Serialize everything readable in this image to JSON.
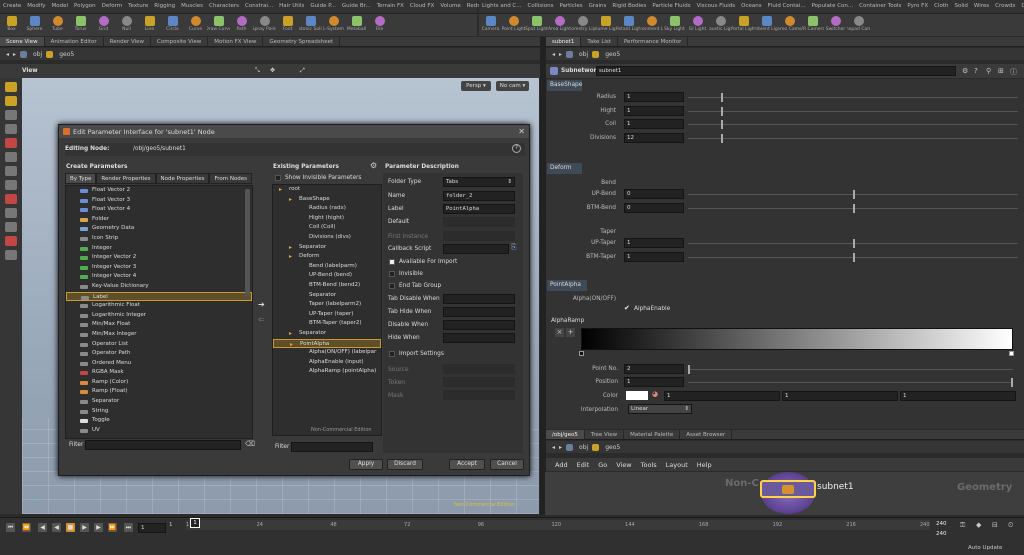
{
  "shelf_left": {
    "tabs": [
      "Create",
      "Modify",
      "Model",
      "Polygon",
      "Deform",
      "Texture",
      "Rigging",
      "Muscles",
      "Characters",
      "Constrai...",
      "Hair Utils",
      "Guide P...",
      "Guide Br...",
      "Terrain FX",
      "Cloud FX",
      "Volume",
      "Redshift"
    ],
    "tools": [
      "Box",
      "Sphere",
      "Tube",
      "Torus",
      "Grid",
      "Null",
      "Line",
      "Circle",
      "Curve",
      "Draw Curve",
      "Path",
      "Spray Paint",
      "Font",
      "Platonic Solids",
      "L-System",
      "Metaball",
      "File"
    ]
  },
  "shelf_right": {
    "tabs": [
      "Lights and C...",
      "Collisions",
      "Particles",
      "Grains",
      "Rigid Bodies",
      "Particle Fluids",
      "Viscous Fluids",
      "Oceans",
      "Fluid Contai...",
      "Populate Con...",
      "Container Tools",
      "Pyro FX",
      "Cloth",
      "Solid",
      "Wires",
      "Crowds",
      "Drive Simula..."
    ],
    "tools": [
      "Camera",
      "Point Light",
      "Spot Light",
      "Area Light",
      "Geometry Light",
      "Volume Light",
      "Distant Light",
      "Environment Light",
      "Sky Light",
      "GI Light",
      "Caustic Light",
      "Portal Light",
      "Ambient Light",
      "Stereo Camera",
      "VR Camera",
      "Switcher",
      "Gamepad Camera"
    ]
  },
  "left_panel": {
    "tabs": [
      "Scene View",
      "Animation Editor",
      "Render View",
      "Composite View",
      "Motion FX View",
      "Geometry Spreadsheet"
    ],
    "path": [
      "obj",
      "geo5"
    ],
    "view_label": "View",
    "persp": "Persp ▾",
    "nocam": "No cam ▾",
    "non_commercial": "Non-Commercial Edition"
  },
  "dialog": {
    "title": "Edit Parameter Interface for 'subnet1' Node",
    "editing_node_label": "Editing Node:",
    "editing_node_value": "/obj/geo5/subnet1",
    "create_params": {
      "title": "Create Parameters",
      "tabs": [
        "By Type",
        "Render Properties",
        "Node Properties",
        "From Nodes"
      ],
      "items": [
        {
          "label": "Float Vector 2",
          "color": "#6b8fd6"
        },
        {
          "label": "Float Vector 3",
          "color": "#6b8fd6"
        },
        {
          "label": "Float Vector 4",
          "color": "#6b8fd6"
        },
        {
          "label": "Folder",
          "color": "#d4a84a"
        },
        {
          "label": "Geometry Data",
          "color": "#7aa0d8"
        },
        {
          "label": "Icon Strip",
          "color": "#8a8a8a"
        },
        {
          "label": "Integer",
          "color": "#4fae4f"
        },
        {
          "label": "Integer Vector 2",
          "color": "#4fae4f"
        },
        {
          "label": "Integer Vector 3",
          "color": "#4fae4f"
        },
        {
          "label": "Integer Vector 4",
          "color": "#4fae4f"
        },
        {
          "label": "Key-Value Dictionary",
          "color": "#8a8a8a"
        },
        {
          "label": "Label",
          "color": "#8a8a8a"
        },
        {
          "label": "Logarithmic Float",
          "color": "#8a8a8a"
        },
        {
          "label": "Logarithmic Integer",
          "color": "#8a8a8a"
        },
        {
          "label": "Min/Max Float",
          "color": "#8a8a8a"
        },
        {
          "label": "Min/Max Integer",
          "color": "#8a8a8a"
        },
        {
          "label": "Operator List",
          "color": "#8a8a8a"
        },
        {
          "label": "Operator Path",
          "color": "#8a8a8a"
        },
        {
          "label": "Ordered Menu",
          "color": "#8a8a8a"
        },
        {
          "label": "RGBA Mask",
          "color": "#c24646"
        },
        {
          "label": "Ramp (Color)",
          "color": "#d98a3a"
        },
        {
          "label": "Ramp (Float)",
          "color": "#d98a3a"
        },
        {
          "label": "Separator",
          "color": "#8a8a8a"
        },
        {
          "label": "String",
          "color": "#8a8a8a"
        },
        {
          "label": "Toggle",
          "color": "#dddddd"
        },
        {
          "label": "UV",
          "color": "#8a8a8a"
        }
      ],
      "selected_index": 11,
      "filter_label": "Filter"
    },
    "existing_params": {
      "title": "Existing Parameters",
      "show_invisible": "Show Invisible Parameters",
      "items": [
        {
          "label": "root",
          "indent": 1
        },
        {
          "label": "BaseShape",
          "indent": 2
        },
        {
          "label": "Radius (radx)",
          "indent": 3
        },
        {
          "label": "Hight (hight)",
          "indent": 3
        },
        {
          "label": "Coil (Coil)",
          "indent": 3
        },
        {
          "label": "Divisions (divs)",
          "indent": 3
        },
        {
          "label": "Separator",
          "indent": 2
        },
        {
          "label": "Deform",
          "indent": 2
        },
        {
          "label": "Bend (labelparm)",
          "indent": 3
        },
        {
          "label": "UP-Bend (bend)",
          "indent": 3
        },
        {
          "label": "BTM-Bend (bend2)",
          "indent": 3
        },
        {
          "label": "Separator",
          "indent": 3
        },
        {
          "label": "Taper (labelparm2)",
          "indent": 3
        },
        {
          "label": "UP-Taper (taper)",
          "indent": 3
        },
        {
          "label": "BTM-Taper (taper2)",
          "indent": 3
        },
        {
          "label": "Separator",
          "indent": 2
        },
        {
          "label": "PointAlpha",
          "indent": 2
        },
        {
          "label": "Alpha(ON/OFF) (labelpar",
          "indent": 3
        },
        {
          "label": "AlphaEnable (input)",
          "indent": 3
        },
        {
          "label": "AlphaRamp (pointAlpha)",
          "indent": 3
        }
      ],
      "selected_index": 16,
      "filter_label": "Filter",
      "non_commercial": "Non-Commercial Edition"
    },
    "param_desc": {
      "title": "Parameter Description",
      "folder_type_label": "Folder Type",
      "folder_type_value": "Tabs",
      "name_label": "Name",
      "name_value": "folder_2",
      "label_label": "Label",
      "label_value": "PointAlpha",
      "default_label": "Default",
      "first_instance_label": "First Instance",
      "callback_label": "Callback Script",
      "available_import": "Available For Import",
      "invisible": "Invisible",
      "end_tab_group": "End Tab Group",
      "tab_disable_when": "Tab Disable When",
      "tab_hide_when": "Tab Hide When",
      "disable_when": "Disable When",
      "hide_when": "Hide When",
      "import_settings": "Import Settings",
      "source": "Source",
      "token": "Token",
      "mask": "Mask"
    },
    "buttons": {
      "apply": "Apply",
      "discard": "Discard",
      "accept": "Accept",
      "cancel": "Cancel"
    }
  },
  "right_panel": {
    "tabs": [
      "subnet1",
      "Take List",
      "Performance Monitor"
    ],
    "path": [
      "obj",
      "geo5"
    ],
    "node_type": "Subnetwork",
    "node_name": "subnet1",
    "sections": {
      "baseshape": {
        "title": "BaseShape",
        "params": [
          {
            "label": "Radius",
            "value": "1",
            "level": 0.1
          },
          {
            "label": "Hight",
            "value": "1",
            "level": 0.1
          },
          {
            "label": "Coil",
            "value": "1",
            "level": 0.1
          },
          {
            "label": "Divisions",
            "value": "12",
            "level": 0.1
          }
        ]
      },
      "deform": {
        "title": "Deform",
        "bend_label": "Bend",
        "taper_label": "Taper",
        "params": [
          {
            "label": "UP-Bend",
            "value": "0",
            "level": 0.5
          },
          {
            "label": "BTM-Bend",
            "value": "0",
            "level": 0.5
          },
          {
            "label": "UP-Taper",
            "value": "1",
            "level": 0.5
          },
          {
            "label": "BTM-Taper",
            "value": "1",
            "level": 0.5
          }
        ]
      },
      "pointalpha": {
        "title": "PointAlpha",
        "alpha_label": "Alpha(ON/OFF)",
        "alpha_enable": "AlphaEnable",
        "ramp_label": "AlphaRamp",
        "point_no_label": "Point No.",
        "point_no_value": "2",
        "position_label": "Position",
        "position_value": "1",
        "color_label": "Color",
        "color_values": [
          "1",
          "1",
          "1"
        ],
        "interp_label": "Interpolation",
        "interp_value": "Linear"
      }
    }
  },
  "network": {
    "tabs": [
      "/obj/geo5",
      "Tree View",
      "Material Palette",
      "Asset Browser"
    ],
    "path": [
      "obj",
      "geo5"
    ],
    "menu": [
      "Add",
      "Edit",
      "Go",
      "View",
      "Tools",
      "Layout",
      "Help"
    ],
    "node_label": "subnet1",
    "watermark_left": "Non-C",
    "watermark_right": "Geometry"
  },
  "timeline": {
    "frame": "1",
    "start": "1",
    "ticks": [
      "1",
      "24",
      "48",
      "72",
      "96",
      "120",
      "144",
      "168",
      "192",
      "216",
      "240"
    ],
    "end1": "240",
    "end2": "240",
    "auto_update": "Auto Update"
  },
  "colors": {
    "accent": "#c89b2e",
    "selection": "#5e4e2a"
  }
}
